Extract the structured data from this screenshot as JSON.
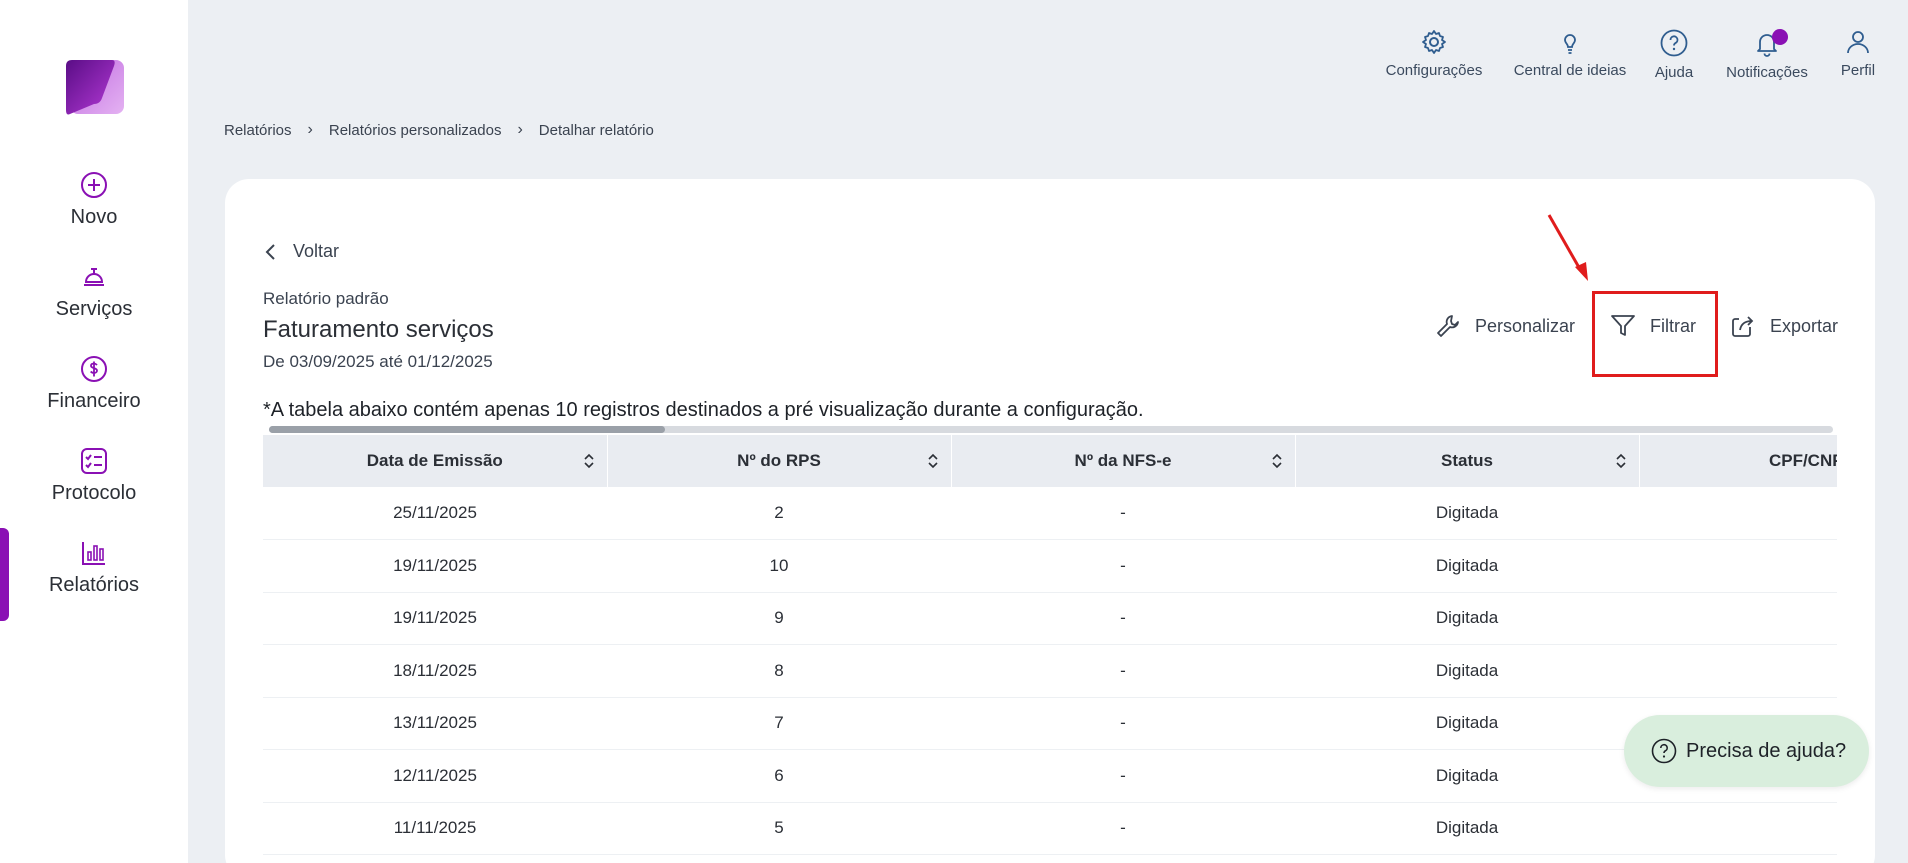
{
  "colors": {
    "accent": "#8a10b4",
    "highlight": "#e01c1c",
    "help_bg": "#d9eedd"
  },
  "sidebar": {
    "items": [
      {
        "label": "Novo",
        "icon": "plus-circle-icon"
      },
      {
        "label": "Serviços",
        "icon": "service-bell-icon"
      },
      {
        "label": "Financeiro",
        "icon": "dollar-circle-icon"
      },
      {
        "label": "Protocolo",
        "icon": "checklist-icon"
      },
      {
        "label": "Relatórios",
        "icon": "bar-chart-icon",
        "active": true
      }
    ]
  },
  "topbar": {
    "actions": [
      {
        "label": "Configurações",
        "icon": "gear-icon"
      },
      {
        "label": "Central de ideias",
        "icon": "lightbulb-icon"
      },
      {
        "label": "Ajuda",
        "icon": "help-circle-icon"
      },
      {
        "label": "Notificações",
        "icon": "bell-icon"
      },
      {
        "label": "Perfil",
        "icon": "user-icon"
      }
    ]
  },
  "breadcrumb": [
    "Relatórios",
    "Relatórios personalizados",
    "Detalhar relatório"
  ],
  "report": {
    "back_label": "Voltar",
    "subtitle": "Relatório padrão",
    "title": "Faturamento serviços",
    "date_range": "De 03/09/2025 até 01/12/2025",
    "actions": {
      "customize": "Personalizar",
      "filter": "Filtrar",
      "export": "Exportar"
    },
    "note": "*A tabela abaixo contém apenas 10 registros destinados a pré visualização durante a configuração."
  },
  "table": {
    "headers": [
      "Data de Emissão",
      "Nº do RPS",
      "Nº da NFS-e",
      "Status",
      "CPF/CNPJ"
    ],
    "rows": [
      [
        "25/11/2025",
        "2",
        "-",
        "Digitada",
        ""
      ],
      [
        "19/11/2025",
        "10",
        "-",
        "Digitada",
        ""
      ],
      [
        "19/11/2025",
        "9",
        "-",
        "Digitada",
        ""
      ],
      [
        "18/11/2025",
        "8",
        "-",
        "Digitada",
        ""
      ],
      [
        "13/11/2025",
        "7",
        "-",
        "Digitada",
        ""
      ],
      [
        "12/11/2025",
        "6",
        "-",
        "Digitada",
        ""
      ],
      [
        "11/11/2025",
        "5",
        "-",
        "Digitada",
        ""
      ]
    ]
  },
  "help": {
    "label": "Precisa de ajuda?"
  }
}
